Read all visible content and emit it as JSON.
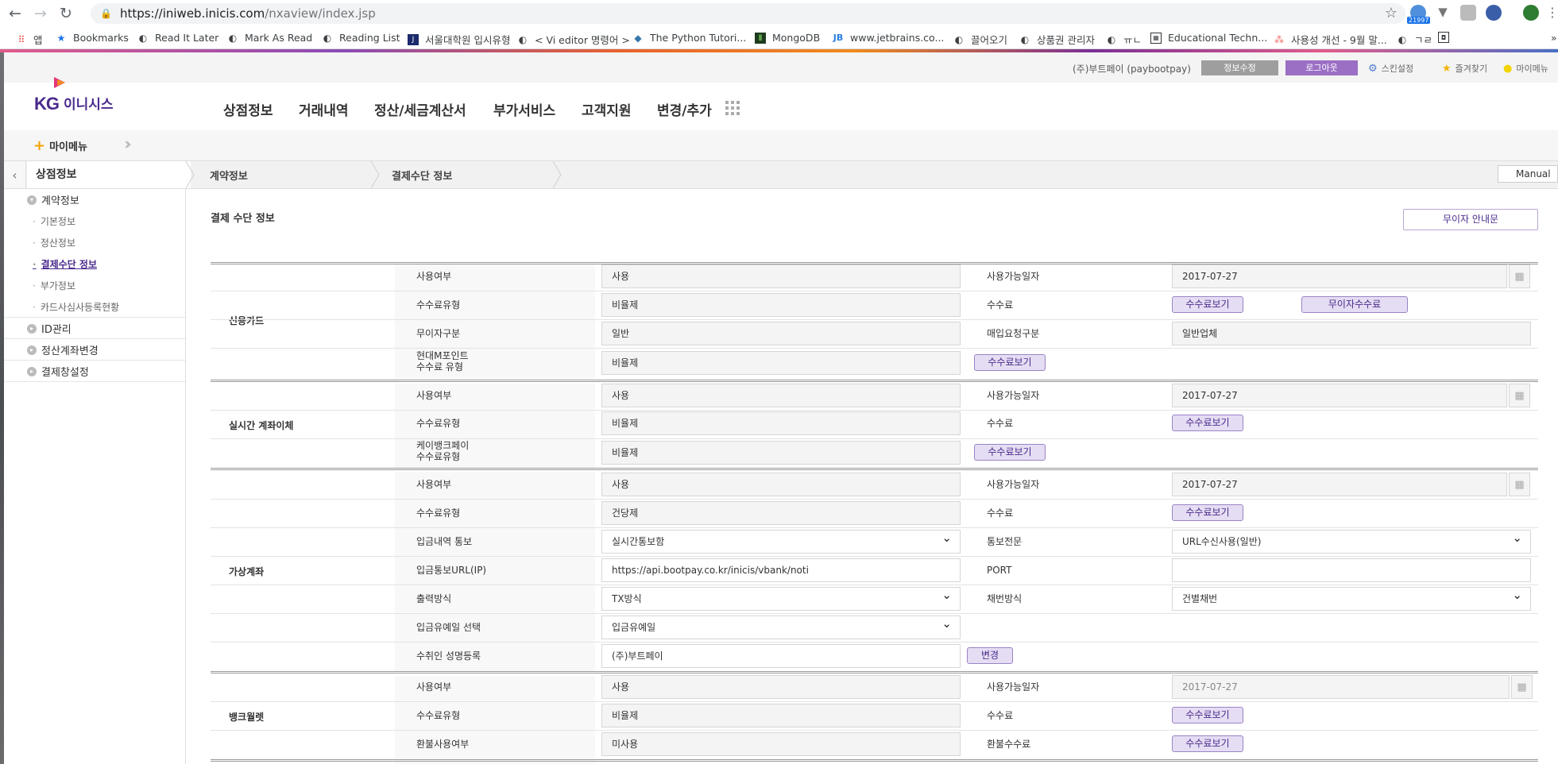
{
  "browser": {
    "url_host": "https://iniweb.inicis.com",
    "url_path": "/nxaview/index.jsp",
    "ext_badge": "21997",
    "bookmarks": [
      "앱",
      "Bookmarks",
      "Read It Later",
      "Mark As Read",
      "Reading List",
      "서울대학원 입시유형",
      "< Vi editor 명령어 >",
      "The Python Tutori...",
      "MongoDB",
      "www.jetbrains.co...",
      "끌어오기",
      "상품권 관리자",
      "ㅠㄴ",
      "Educational Techn...",
      "사용성 개선 - 9월 말...",
      "ㄱㄹ",
      ""
    ]
  },
  "util": {
    "company": "(주)부트페이 (paybootpay)",
    "info_btn": "정보수정",
    "logout_btn": "로그아웃",
    "skin": "스킨설정",
    "favorites": "즐겨찾기",
    "mymenu": "마이메뉴"
  },
  "logo": {
    "kg": "KG",
    "name": "이니시스"
  },
  "gnb": [
    "상점정보",
    "거래내역",
    "정산/세금계산서",
    "부가서비스",
    "고객지원",
    "변경/추가"
  ],
  "mymenu_label": "마이메뉴",
  "breadcrumb": {
    "title": "상점정보",
    "items": [
      "계약정보",
      "결제수단 정보"
    ],
    "manual": "Manual"
  },
  "lnb": {
    "groups": [
      "계약정보",
      "ID관리",
      "정산계좌변경",
      "결제창설정"
    ],
    "subs": [
      "기본정보",
      "정산정보",
      "결제수단 정보",
      "부가정보",
      "카드사심사등록현황"
    ]
  },
  "content": {
    "title": "결제 수단 정보",
    "guide_btn": "무이자 안내문",
    "fee_btn": "수수료보기",
    "free_fee_btn": "무이자수수료",
    "change_btn": "변경",
    "sections": {
      "card": {
        "name": "신용카드",
        "use_label": "사용여부",
        "use_val": "사용",
        "date_label": "사용가능일자",
        "date_val": "2017-07-27",
        "fee_type_label": "수수료유형",
        "fee_type_val": "비율제",
        "fee_label": "수수료",
        "install_label": "무이자구분",
        "install_val": "일반",
        "buy_label": "매입요청구분",
        "buy_val": "일반업체",
        "point_label_1": "현대M포인트",
        "point_label_2": "수수료 유형",
        "point_val": "비율제"
      },
      "realtime": {
        "name": "실시간 계좌이체",
        "use_label": "사용여부",
        "use_val": "사용",
        "date_label": "사용가능일자",
        "date_val": "2017-07-27",
        "fee_type_label": "수수료유형",
        "fee_type_val": "비율제",
        "fee_label": "수수료",
        "kbank_label_1": "케이뱅크페이",
        "kbank_label_2": "수수료유형",
        "kbank_val": "비율제"
      },
      "vbank": {
        "name": "가상계좌",
        "use_label": "사용여부",
        "use_val": "사용",
        "date_label": "사용가능일자",
        "date_val": "2017-07-27",
        "fee_type_label": "수수료유형",
        "fee_type_val": "건당제",
        "fee_label": "수수료",
        "notice_label": "입금내역 통보",
        "notice_val": "실시간통보함",
        "msg_label": "통보전문",
        "msg_val": "URL수신사용(일반)",
        "url_label": "입금통보URL(IP)",
        "url_val": "https://api.bootpay.co.kr/inicis/vbank/noti",
        "port_label": "PORT",
        "port_val": "",
        "output_label": "출력방식",
        "output_val": "TX방식",
        "issue_label": "채번방식",
        "issue_val": "건별채번",
        "email_label": "입금유예일 선택",
        "email_val": "입금유예일",
        "payee_label": "수취인 성명등록",
        "payee_val": "(주)부트페이"
      },
      "wallet": {
        "name": "뱅크월렛",
        "use_label": "사용여부",
        "use_val": "사용",
        "date_label": "사용가능일자",
        "date_val": "2017-07-27",
        "fee_type_label": "수수료유형",
        "fee_type_val": "비율제",
        "fee_label": "수수료",
        "refund_label": "환불사용여부",
        "refund_val": "미사용",
        "refund_fee_label": "환불수수료"
      }
    }
  }
}
